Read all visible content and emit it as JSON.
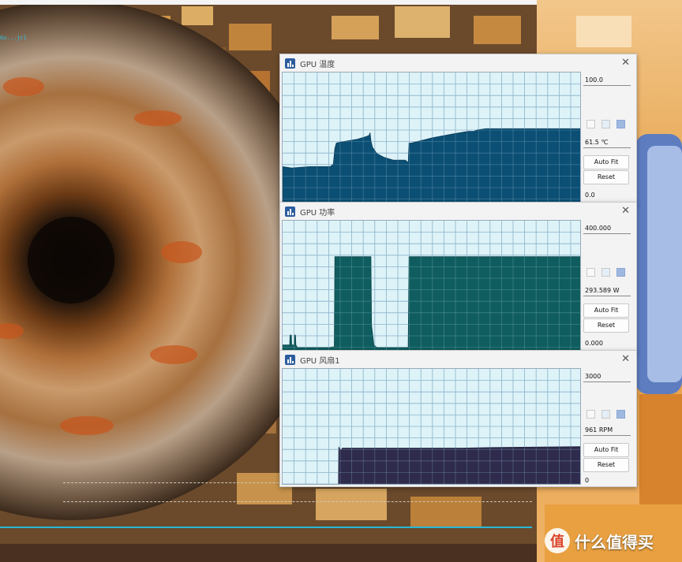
{
  "left_label": "Gv...jr]",
  "windows": [
    {
      "title": "GPU 温度",
      "max_label": "100.0",
      "current_label": "61.5 ℃",
      "min_label": "0.0",
      "auto_fit": "Auto Fit",
      "reset": "Reset",
      "fill_color": "#0c4f74",
      "stroke_color": "#0a3e5e",
      "chart_data": {
        "type": "area",
        "ylim": [
          0,
          100
        ],
        "series": [
          {
            "values": [
              [
                0,
                28
              ],
              [
                3,
                27
              ],
              [
                9,
                28
              ],
              [
                16,
                28
              ],
              [
                17,
                30
              ],
              [
                17.5,
                42
              ],
              [
                18,
                46
              ],
              [
                20,
                47
              ],
              [
                25,
                49
              ],
              [
                28,
                51
              ],
              [
                29,
                52
              ],
              [
                29.2,
                54
              ],
              [
                29.5,
                48
              ],
              [
                30,
                43
              ],
              [
                31.5,
                38
              ],
              [
                34,
                35
              ],
              [
                37,
                33
              ],
              [
                41,
                33
              ],
              [
                42,
                31
              ],
              [
                42.3,
                46
              ],
              [
                43,
                46
              ],
              [
                50,
                50
              ],
              [
                57,
                53
              ],
              [
                62,
                55
              ],
              [
                64,
                55
              ],
              [
                65,
                56
              ],
              [
                68,
                57
              ],
              [
                78,
                57
              ],
              [
                100,
                57
              ]
            ]
          }
        ]
      }
    },
    {
      "title": "GPU 功率",
      "max_label": "400.000",
      "current_label": "293.589 W",
      "min_label": "0.000",
      "auto_fit": "Auto Fit",
      "reset": "Reset",
      "fill_color": "#0f5d5f",
      "stroke_color": "#0b4a4b",
      "chart_data": {
        "type": "area",
        "ylim": [
          0,
          400
        ],
        "series": [
          {
            "values": [
              [
                0,
                20
              ],
              [
                2.4,
                20
              ],
              [
                2.5,
                50
              ],
              [
                2.9,
                50
              ],
              [
                3,
                20
              ],
              [
                3.9,
                20
              ],
              [
                4,
                50
              ],
              [
                4.3,
                50
              ],
              [
                4.4,
                20
              ],
              [
                5,
                12
              ],
              [
                16,
                12
              ],
              [
                16.5,
                14
              ],
              [
                17.3,
                14
              ],
              [
                17.5,
                290
              ],
              [
                29.5,
                290
              ],
              [
                29.7,
                80
              ],
              [
                30.5,
                20
              ],
              [
                31.5,
                12
              ],
              [
                42,
                12
              ],
              [
                42.3,
                290
              ],
              [
                100,
                290
              ]
            ]
          }
        ]
      }
    },
    {
      "title": "GPU 风扇1",
      "max_label": "3000",
      "current_label": "961 RPM",
      "min_label": "0",
      "auto_fit": "Auto Fit",
      "reset": "Reset",
      "fill_color": "#2e2b4d",
      "stroke_color": "#23213e",
      "chart_data": {
        "type": "area",
        "ylim": [
          0,
          3000
        ],
        "series": [
          {
            "values": [
              [
                0,
                0
              ],
              [
                18.7,
                0
              ],
              [
                18.8,
                980
              ],
              [
                19.5,
                900
              ],
              [
                20,
                960
              ],
              [
                60,
                960
              ],
              [
                70,
                975
              ],
              [
                100,
                1000
              ]
            ]
          }
        ]
      }
    }
  ],
  "watermark": {
    "icon_char": "值",
    "text": "什么值得买"
  }
}
